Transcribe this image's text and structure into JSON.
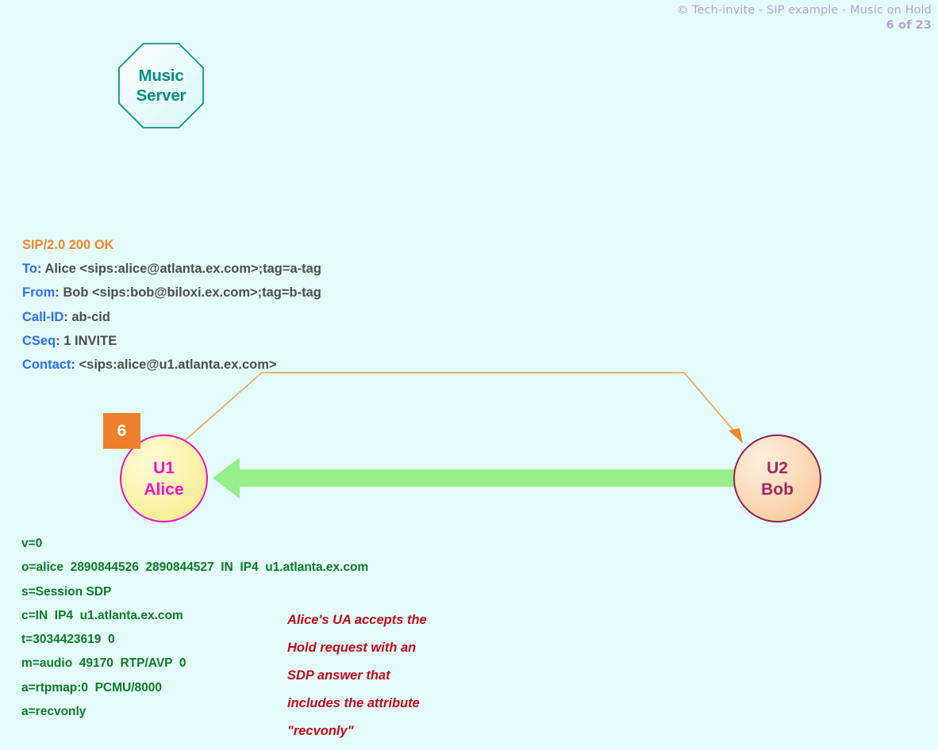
{
  "header": {
    "copyright_line": "© Tech-invite - SIP example - Music on Hold",
    "page_indicator": "6 of 23"
  },
  "nodes": {
    "music_server": {
      "line1": "Music",
      "line2": "Server"
    },
    "alice": {
      "line1": "U1",
      "line2": "Alice"
    },
    "bob": {
      "line1": "U2",
      "line2": "Bob"
    }
  },
  "step": {
    "number": "6"
  },
  "sip_message": {
    "status_line": "SIP/2.0 200 OK",
    "headers": [
      {
        "name": "To",
        "value": "Alice <sips:alice@atlanta.ex.com>;tag=a-tag"
      },
      {
        "name": "From",
        "value": "Bob <sips:bob@biloxi.ex.com>;tag=b-tag"
      },
      {
        "name": "Call-ID",
        "value": "ab-cid"
      },
      {
        "name": "CSeq",
        "value": "1 INVITE"
      },
      {
        "name": "Contact",
        "value": "<sips:alice@u1.atlanta.ex.com>"
      }
    ]
  },
  "sdp_body": {
    "lines": [
      "v=0",
      "o=alice  2890844526  2890844527  IN  IP4  u1.atlanta.ex.com",
      "s=Session SDP",
      "c=IN  IP4  u1.atlanta.ex.com",
      "t=3034423619  0",
      "m=audio  49170  RTP/AVP  0",
      "a=rtpmap:0  PCMU/8000",
      "a=recvonly"
    ],
    "text": "v=0\no=alice  2890844526  2890844527  IN  IP4  u1.atlanta.ex.com\ns=Session SDP\nc=IN  IP4  u1.atlanta.ex.com\nt=3034423619  0\nm=audio  49170  RTP/AVP  0\na=rtpmap:0  PCMU/8000\na=recvonly"
  },
  "annotation": {
    "lines": [
      "Alice's UA accepts the",
      "Hold request with an",
      "SDP answer that",
      "includes the attribute",
      "\"recvonly\""
    ],
    "text": "Alice's UA accepts the Hold request with an SDP answer that includes the attribute \"recvonly\""
  },
  "colors": {
    "background": "#e4fcfc",
    "header_text": "#b3a4cf",
    "status_line": "#f5842a",
    "header_name": "#2b6ff5",
    "header_value": "#4d4d4d",
    "sdp_text": "#0a7d22",
    "annotation_text": "#c40a18",
    "step_badge": "#ef7f2c",
    "message_arrow": "#90ee90",
    "connector": "#f4a460",
    "octagon_stroke": "#0f8f88",
    "alice_stroke": "#e612c6",
    "bob_stroke": "#8e2253"
  },
  "flow": {
    "message_arrow_direction": "right-to-left",
    "message_arrow_from": "U2 Bob",
    "message_arrow_to": "U1 Alice"
  }
}
